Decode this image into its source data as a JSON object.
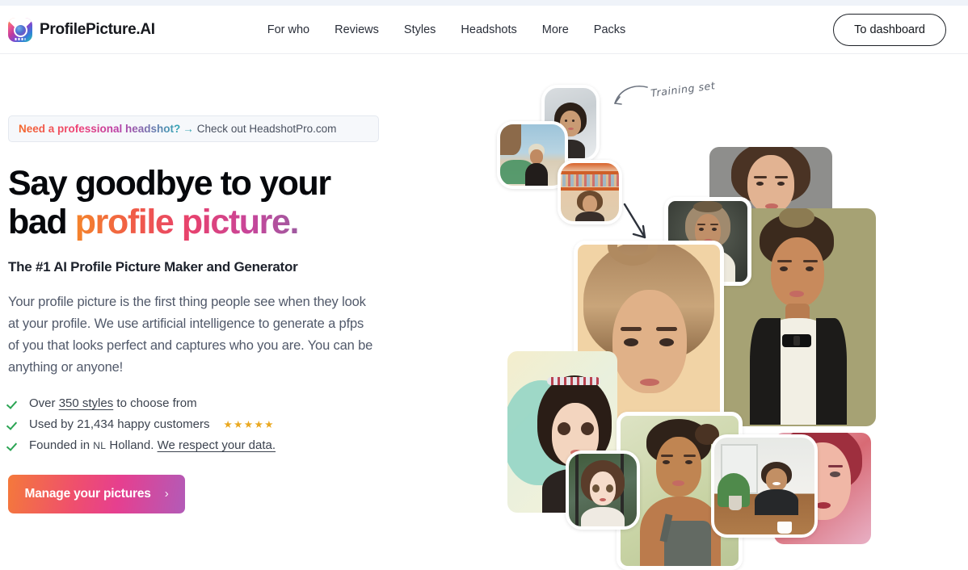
{
  "header": {
    "brand_name": "ProfilePicture.AI",
    "logo_icon": "camera-house-logo-icon",
    "nav": [
      {
        "label": "For who"
      },
      {
        "label": "Reviews"
      },
      {
        "label": "Styles"
      },
      {
        "label": "Headshots"
      },
      {
        "label": "More"
      },
      {
        "label": "Packs"
      }
    ],
    "dashboard_button": "To dashboard"
  },
  "promo": {
    "strong": "Need a professional headshot?",
    "arrow": "→",
    "rest": "Check out HeadshotPro.com"
  },
  "hero": {
    "headline_line1": "Say goodbye to your",
    "headline_line2_plain": "bad ",
    "headline_line2_gradient": "profile picture.",
    "subhead": "The #1 AI Profile Picture Maker and Generator",
    "body": "Your profile picture is the first thing people see when they look at your profile. We use artificial intelligence to generate a pfps of you that looks perfect and captures who you are. You can be anything or anyone!",
    "bullets": [
      {
        "icon": "check-icon",
        "pre": "Over ",
        "link": "350 styles",
        "post": " to choose from",
        "stars": "",
        "smallcaps": ""
      },
      {
        "icon": "check-icon",
        "pre": "Used by 21,434 happy customers",
        "link": "",
        "post": "",
        "stars": "★★★★★",
        "smallcaps": ""
      },
      {
        "icon": "check-icon",
        "pre": "Founded in ",
        "smallcaps": "NL",
        "mid": " Holland. ",
        "link": "We respect your data.",
        "post": "",
        "stars": ""
      }
    ],
    "cta_label": "Manage your pictures",
    "cta_chevron": "›"
  },
  "collage": {
    "annotation_text": "Training set",
    "annotation_arrow_icon": "curved-arrow-icon",
    "flow_arrow_icon": "down-arrow-icon"
  },
  "colors": {
    "accent_orange": "#f4792b",
    "accent_pink": "#e63f8f",
    "accent_purple": "#9f5aa0",
    "accent_teal": "#2fa8b5",
    "check_green": "#2aa453",
    "star_gold": "#eaa820",
    "text_dark": "#06080c",
    "text_body": "#51596a",
    "top_strip": "#eff3f9",
    "banner_bg": "#f6f8fb"
  }
}
